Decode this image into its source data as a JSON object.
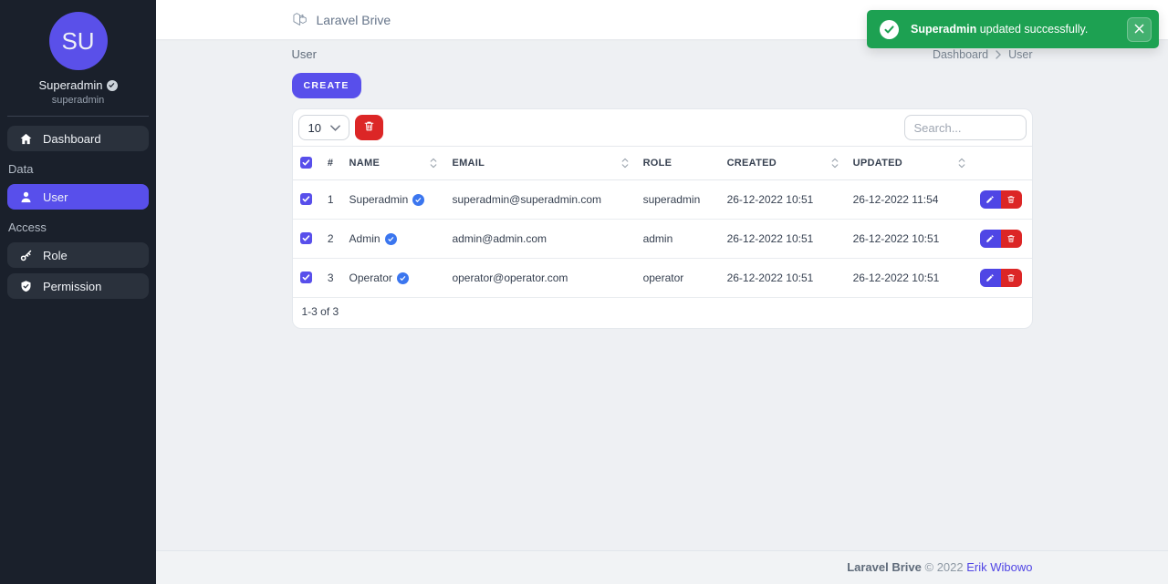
{
  "header": {
    "brand": "Laravel Brive"
  },
  "sidebar": {
    "avatar_initials": "SU",
    "name": "Superadmin",
    "username": "superadmin",
    "nav": {
      "dashboard": "Dashboard",
      "section_data": "Data",
      "user": "User",
      "section_access": "Access",
      "role": "Role",
      "permission": "Permission"
    }
  },
  "page": {
    "title": "User",
    "breadcrumb": {
      "parent": "Dashboard",
      "current": "User"
    }
  },
  "toolbar": {
    "create_label": "CREATE",
    "per_page": "10",
    "search_placeholder": "Search..."
  },
  "table": {
    "headers": {
      "num": "#",
      "name": "NAME",
      "email": "EMAIL",
      "role": "ROLE",
      "created": "CREATED",
      "updated": "UPDATED"
    },
    "rows": [
      {
        "num": "1",
        "name": "Superadmin",
        "email": "superadmin@superadmin.com",
        "role": "superadmin",
        "created": "26-12-2022 10:51",
        "updated": "26-12-2022 11:54"
      },
      {
        "num": "2",
        "name": "Admin",
        "email": "admin@admin.com",
        "role": "admin",
        "created": "26-12-2022 10:51",
        "updated": "26-12-2022 10:51"
      },
      {
        "num": "3",
        "name": "Operator",
        "email": "operator@operator.com",
        "role": "operator",
        "created": "26-12-2022 10:51",
        "updated": "26-12-2022 10:51"
      }
    ],
    "pagination": "1-3 of 3"
  },
  "toast": {
    "highlight": "Superadmin",
    "message": "updated successfully."
  },
  "footer": {
    "brand": "Laravel Brive",
    "copyright": "© 2022",
    "author": "Erik Wibowo"
  },
  "colors": {
    "accent": "#584feb",
    "danger": "#dc2626",
    "success": "#1da152",
    "verified_badge": "#3b76ef",
    "sidebar_bg": "#1a202b",
    "content_bg": "#eef0f3"
  },
  "icons": {
    "laravel_logo": "laravel-logo-icon",
    "home": "home-icon",
    "user": "user-icon",
    "key": "key-icon",
    "shield": "shield-check-icon",
    "trash": "trash-icon",
    "pencil": "pencil-icon",
    "check": "check-icon",
    "close": "close-icon",
    "sort": "sort-icon",
    "chevron_down": "chevron-down-icon",
    "chevron_right": "chevron-right-icon"
  }
}
